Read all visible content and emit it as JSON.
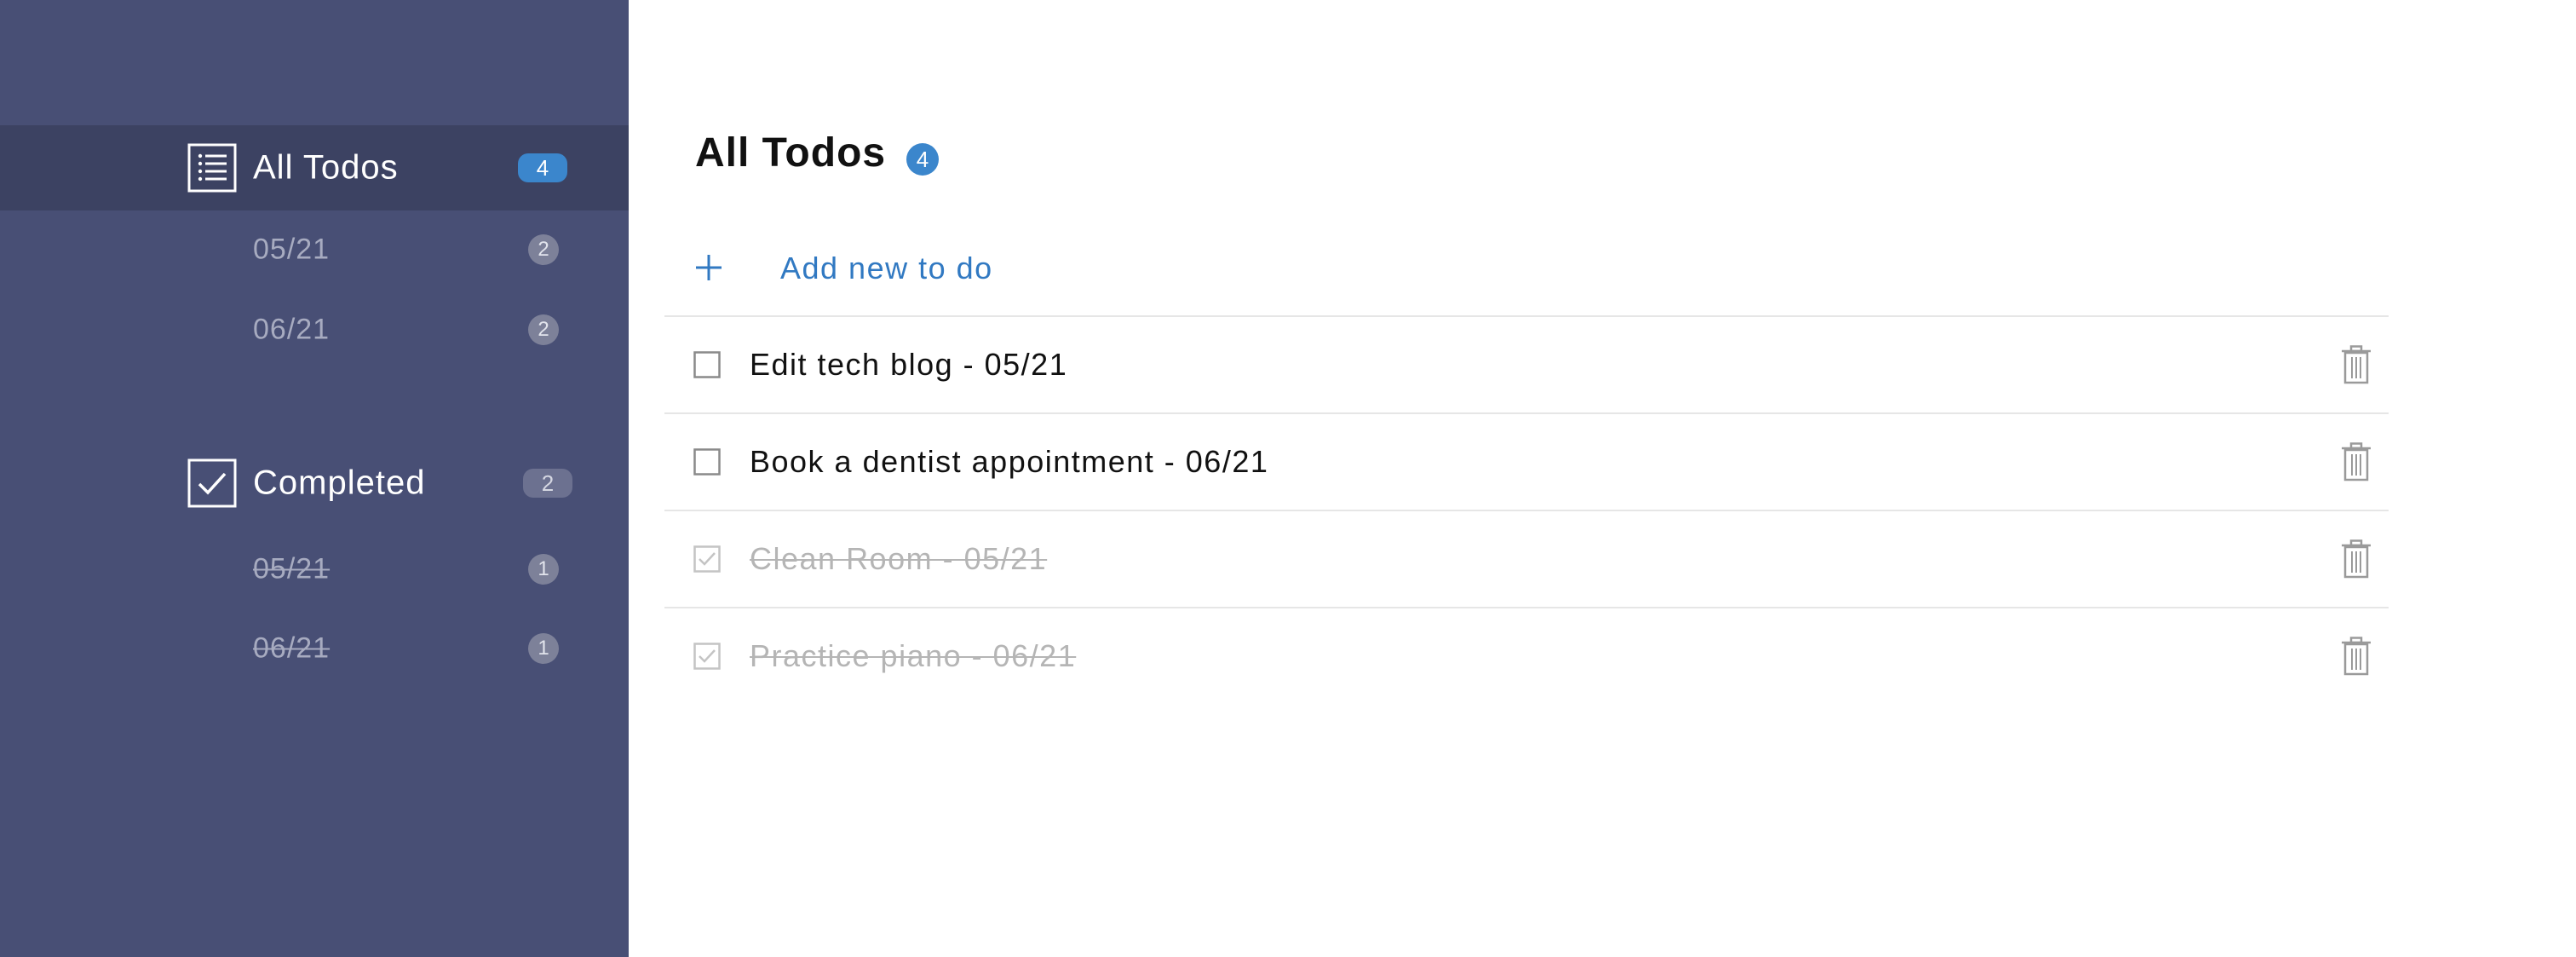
{
  "sidebar": {
    "all": {
      "label": "All Todos",
      "count": "4",
      "icon": "list-icon",
      "items": [
        {
          "label": "05/21",
          "count": "2"
        },
        {
          "label": "06/21",
          "count": "2"
        }
      ]
    },
    "completed": {
      "label": "Completed",
      "count": "2",
      "icon": "checkbox-checked-icon",
      "items": [
        {
          "label": "05/21",
          "count": "1"
        },
        {
          "label": "06/21",
          "count": "1"
        }
      ]
    }
  },
  "main": {
    "title": "All Todos",
    "count": "4",
    "add_label": "Add new to do",
    "todos": [
      {
        "text": "Edit tech blog - 05/21",
        "done": false
      },
      {
        "text": "Book a dentist appointment - 06/21",
        "done": false
      },
      {
        "text": "Clean Room - 05/21",
        "done": true
      },
      {
        "text": "Practice piano - 06/21",
        "done": true
      }
    ]
  },
  "colors": {
    "sidebar_bg": "#484f75",
    "sidebar_active": "#3c4262",
    "accent": "#3b86cc",
    "link": "#3179c2",
    "done_text": "#b5b5b5"
  }
}
